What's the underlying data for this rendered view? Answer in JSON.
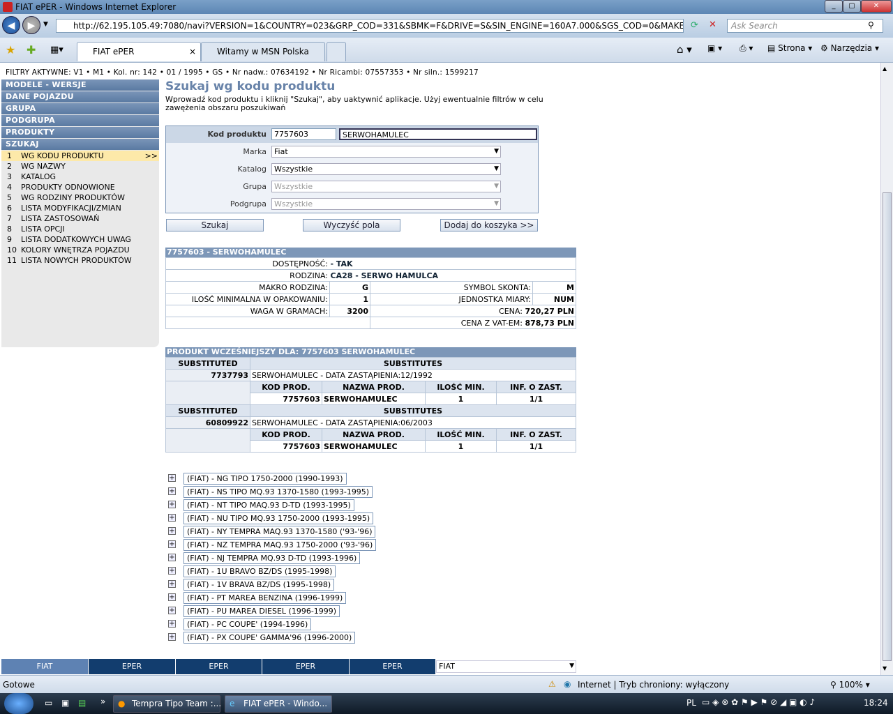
{
  "window": {
    "title": "FIAT ePER - Windows Internet Explorer"
  },
  "browser": {
    "url": "http://62.195.105.49:7080/navi?VERSION=1&COUNTRY=023&GRP_COD=331&SBMK=F&DRIVE=S&SIN_ENGINE=160A7.000&SGS_COD=0&MAKE=F&ENGINE_NO=",
    "search_placeholder": "Ask Search",
    "tabs": [
      {
        "label": "FIAT ePER"
      },
      {
        "label": "Witamy w MSN Polska"
      }
    ],
    "toolbar": {
      "page_label": "Strona",
      "tools_label": "Narzędzia"
    }
  },
  "filters": "FILTRY AKTYWNE:  V1 • M1 • Kol. nr: 142 • 01 / 1995 • GS • Nr nadw.: 07634192 • Nr Ricambi: 07557353 • Nr siln.: 1599217",
  "sidebar": {
    "headers": [
      "MODELE - WERSJE",
      "DANE POJAZDU",
      "GRUPA",
      "PODGRUPA",
      "PRODUKTY",
      "SZUKAJ"
    ],
    "items": [
      {
        "num": "1",
        "label": "WG KODU PRODUKTU",
        "arrow": ">>"
      },
      {
        "num": "2",
        "label": "WG NAZWY"
      },
      {
        "num": "3",
        "label": "KATALOG"
      },
      {
        "num": "4",
        "label": "PRODUKTY ODNOWIONE"
      },
      {
        "num": "5",
        "label": "WG RODZINY PRODUKTÓW"
      },
      {
        "num": "6",
        "label": "LISTA MODYFIKACJI/ZMIAN"
      },
      {
        "num": "7",
        "label": "LISTA ZASTOSOWAŃ"
      },
      {
        "num": "8",
        "label": "LISTA OPCJI"
      },
      {
        "num": "9",
        "label": "LISTA DODATKOWYCH UWAG"
      },
      {
        "num": "10",
        "label": "KOLORY WNĘTRZA POJAZDU"
      },
      {
        "num": "11",
        "label": "LISTA NOWYCH PRODUKTÓW"
      }
    ]
  },
  "main": {
    "title": "Szukaj wg kodu produktu",
    "intro": "Wprowadź kod produktu i kliknij \"Szukaj\", aby uaktywnić aplikacje. Użyj ewentualnie filtrów w celu zawężenia obszaru poszukiwań"
  },
  "form": {
    "code_label": "Kod produktu",
    "code_value": "7757603",
    "name_value": "SERWOHAMULEC",
    "make_label": "Marka",
    "make_value": "Fiat",
    "catalog_label": "Katalog",
    "catalog_value": "Wszystkie",
    "group_label": "Grupa",
    "group_value": "Wszystkie",
    "subgroup_label": "Podgrupa",
    "subgroup_value": "Wszystkie",
    "search_btn": "Szukaj",
    "clear_btn": "Wyczyść pola",
    "cart_btn": "Dodaj do koszyka >>"
  },
  "product": {
    "header": "7757603 - SERWOHAMULEC",
    "availability_label": "DOSTĘPNOŚĆ:",
    "availability_value": "- TAK",
    "family_label": "RODZINA:",
    "family_value": "CA28 - SERWO HAMULCA",
    "macro_label": "MAKRO RODZINA:",
    "macro_value": "G",
    "discount_label": "SYMBOL SKONTA:",
    "discount_value": "M",
    "minqty_label": "ILOŚĆ MINIMALNA W OPAKOWANIU:",
    "minqty_value": "1",
    "unit_label": "JEDNOSTKA MIARY:",
    "unit_value": "NUM",
    "weight_label": "WAGA W GRAMACH:",
    "weight_value": "3200",
    "price_label": "CENA:",
    "price_value": "720,27 PLN",
    "vatprice_label": "CENA Z VAT-EM:",
    "vatprice_value": "878,73 PLN"
  },
  "predecessor": {
    "header": "PRODUKT WCZEŚNIEJSZY DLA: 7757603 SERWOHAMULEC",
    "col_substituted": "SUBSTITUTED",
    "col_substitutes": "SUBSTITUTES",
    "col_code": "KOD PROD.",
    "col_name": "NAZWA PROD.",
    "col_minqty": "ILOŚĆ MIN.",
    "col_info": "INF. O ZAST.",
    "entries": [
      {
        "code": "7737793",
        "desc": "SERWOHAMULEC - DATA ZASTĄPIENIA:12/1992",
        "sub_code": "7757603",
        "sub_name": "SERWOHAMULEC",
        "min": "1",
        "info": "1/1"
      },
      {
        "code": "60809922",
        "desc": "SERWOHAMULEC - DATA ZASTĄPIENIA:06/2003",
        "sub_code": "7757603",
        "sub_name": "SERWOHAMULEC",
        "min": "1",
        "info": "1/1"
      }
    ]
  },
  "applications": [
    "(FIAT) - NG TIPO 1750-2000 (1990-1993)",
    "(FIAT) - NS TIPO MQ.93 1370-1580 (1993-1995)",
    "(FIAT) - NT TIPO MAQ.93 D-TD (1993-1995)",
    "(FIAT) - NU TIPO MQ.93 1750-2000 (1993-1995)",
    "(FIAT) - NY TEMPRA MAQ.93 1370-1580 ('93-'96)",
    "(FIAT) - NZ TEMPRA MAQ.93 1750-2000 ('93-'96)",
    "(FIAT) - NJ TEMPRA MQ.93 D-TD (1993-1996)",
    "(FIAT) - 1U BRAVO BZ/DS (1995-1998)",
    "(FIAT) - 1V BRAVA BZ/DS (1995-1998)",
    "(FIAT) - PT MAREA BENZINA (1996-1999)",
    "(FIAT) - PU MAREA DIESEL (1996-1999)",
    "(FIAT) - PC COUPE' (1994-1996)",
    "(FIAT) - PX COUPE' GAMMA'96 (1996-2000)"
  ],
  "footer_nav": {
    "tabs": [
      "FIAT",
      "EPER",
      "EPER",
      "EPER",
      "EPER"
    ],
    "brand_select": "FIAT"
  },
  "status": {
    "left": "Gotowe",
    "zone": "Internet | Tryb chroniony: wyłączony",
    "zoom": "100%"
  },
  "taskbar": {
    "tasks": [
      "Tempra Tipo Team :...",
      "FIAT ePER - Windo..."
    ],
    "lang": "PL",
    "clock": "18:24"
  }
}
